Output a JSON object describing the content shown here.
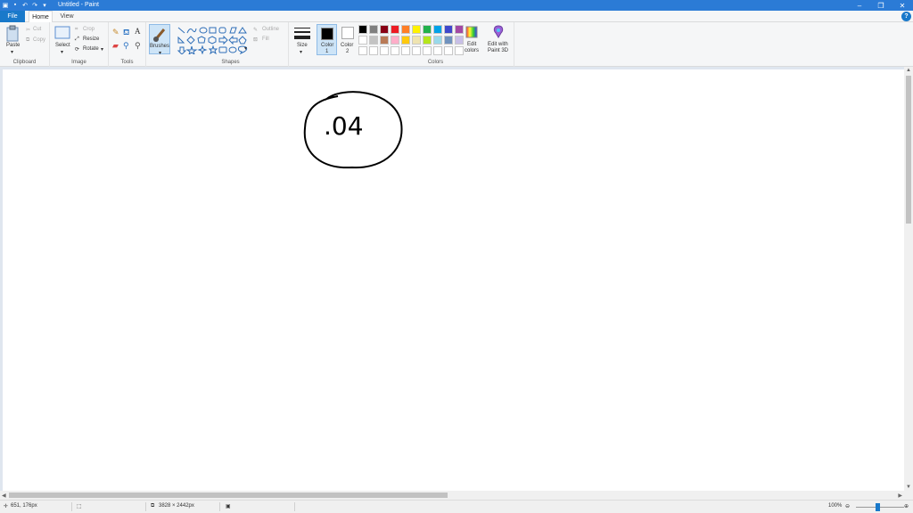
{
  "window": {
    "title": "Untitled - Paint",
    "minimize": "–",
    "restore": "❐",
    "close": "✕"
  },
  "tabs": {
    "file": "File",
    "home": "Home",
    "view": "View",
    "help": "?"
  },
  "clipboard": {
    "paste": "Paste",
    "cut": "Cut",
    "copy": "Copy",
    "label": "Clipboard"
  },
  "image": {
    "select": "Select",
    "crop": "Crop",
    "resize": "Resize",
    "rotate": "Rotate",
    "label": "Image"
  },
  "tools": {
    "label": "Tools",
    "text_tool": "A"
  },
  "brushes": {
    "label": "Brushes"
  },
  "shapes": {
    "outline": "Outline",
    "fill": "Fill",
    "label": "Shapes"
  },
  "size": {
    "label": "Size"
  },
  "color1": {
    "label": "Color",
    "num": "1",
    "value": "#000000"
  },
  "color2": {
    "label": "Color",
    "num": "2",
    "value": "#ffffff"
  },
  "colors": {
    "label": "Colors",
    "edit_line1": "Edit",
    "edit_line2": "colors",
    "paint3d_line1": "Edit with",
    "paint3d_line2": "Paint 3D",
    "palette": [
      "#000000",
      "#7f7f7f",
      "#880015",
      "#ed1c24",
      "#ff7f27",
      "#fff200",
      "#22b14c",
      "#00a2e8",
      "#3f48cc",
      "#a349a4",
      "#ffffff",
      "#c3c3c3",
      "#b97a57",
      "#ffaec9",
      "#ffc90e",
      "#efe4b0",
      "#b5e61d",
      "#99d9ea",
      "#7092be",
      "#c8bfe7",
      "#ffffff",
      "#ffffff",
      "#ffffff",
      "#ffffff",
      "#ffffff",
      "#ffffff",
      "#ffffff",
      "#ffffff",
      "#ffffff",
      "#ffffff"
    ]
  },
  "drawing": {
    "text": ".04"
  },
  "status": {
    "cursor_pos": "651, 176px",
    "image_size": "3828 × 2442px",
    "zoom": "100%"
  }
}
